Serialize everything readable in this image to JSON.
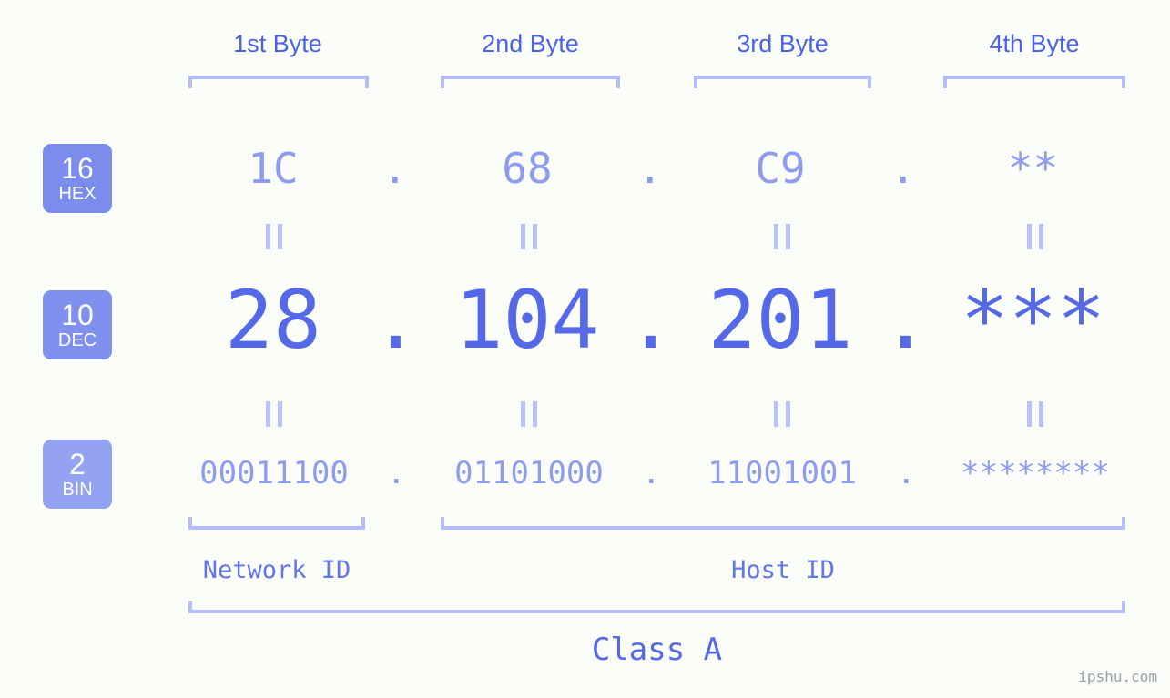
{
  "background_color": "#fbfdf8",
  "accent_color": "#5468e8",
  "muted_accent_color": "#8e9cef",
  "bracket_color": "#b4bdf7",
  "headers": [
    {
      "label": "1st Byte"
    },
    {
      "label": "2nd Byte"
    },
    {
      "label": "3rd Byte"
    },
    {
      "label": "4th Byte"
    }
  ],
  "bases": [
    {
      "number": "16",
      "name": "HEX",
      "color": "#7b8cec"
    },
    {
      "number": "10",
      "name": "DEC",
      "color": "#7f90ee"
    },
    {
      "number": "2",
      "name": "BIN",
      "color": "#93a3f2"
    }
  ],
  "rows": {
    "hex": {
      "bytes": [
        "1C",
        "68",
        "C9",
        "**"
      ],
      "separator": "."
    },
    "dec": {
      "bytes": [
        "28",
        "104",
        "201",
        "***"
      ],
      "separator": "."
    },
    "bin": {
      "bytes": [
        "00011100",
        "01101000",
        "11001001",
        "********"
      ],
      "separator": "."
    }
  },
  "connectors": {
    "glyph": "||",
    "count_per_row": 4
  },
  "segments": {
    "network_id": {
      "label": "Network ID"
    },
    "host_id": {
      "label": "Host ID"
    }
  },
  "class": {
    "label": "Class A"
  },
  "watermark": {
    "text": "ipshu.com"
  }
}
